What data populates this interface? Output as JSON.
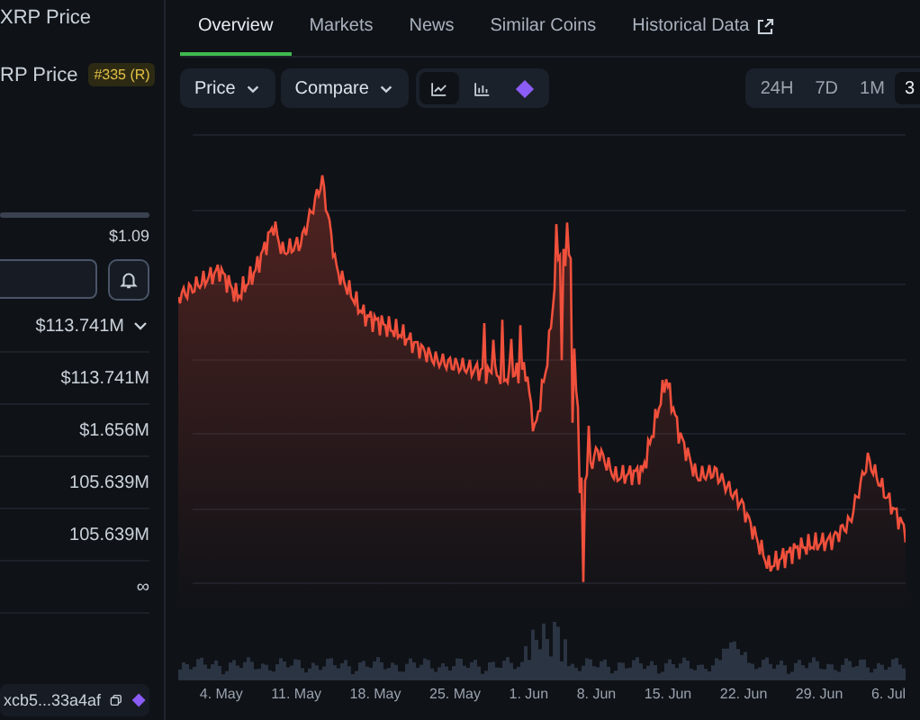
{
  "sidebar": {
    "title": "XRP Price",
    "subtitle": "RP Price",
    "rank_badge": "#335 (R)",
    "range_high": "$1.09",
    "stats": [
      {
        "value": "$113.741M",
        "expandable": true
      },
      {
        "value": "$113.741M",
        "expandable": false
      },
      {
        "value": "$1.656M",
        "expandable": false
      },
      {
        "value": "105.639M",
        "expandable": false
      },
      {
        "value": "105.639M",
        "expandable": false
      },
      {
        "value": "∞",
        "expandable": false
      }
    ],
    "address": "xcb5...33a4af"
  },
  "tabs": [
    {
      "label": "Overview",
      "selected": true,
      "external": false
    },
    {
      "label": "Markets",
      "selected": false,
      "external": false
    },
    {
      "label": "News",
      "selected": false,
      "external": false
    },
    {
      "label": "Similar Coins",
      "selected": false,
      "external": false
    },
    {
      "label": "Historical Data",
      "selected": false,
      "external": true
    }
  ],
  "toolbar": {
    "selectors": [
      {
        "label": "Price"
      },
      {
        "label": "Compare"
      }
    ],
    "chart_types": [
      {
        "kind": "line",
        "selected": true
      },
      {
        "kind": "bar",
        "selected": false
      },
      {
        "kind": "diamond",
        "selected": false
      }
    ],
    "ranges": [
      {
        "label": "24H",
        "selected": false
      },
      {
        "label": "7D",
        "selected": false
      },
      {
        "label": "1M",
        "selected": false
      },
      {
        "label": "3",
        "selected": true
      }
    ]
  },
  "chart": {
    "x_labels": [
      "4. May",
      "11. May",
      "18. May",
      "25. May",
      "1. Jun",
      "8. Jun",
      "15. Jun",
      "22. Jun",
      "29. Jun",
      "6. Jul"
    ]
  }
}
